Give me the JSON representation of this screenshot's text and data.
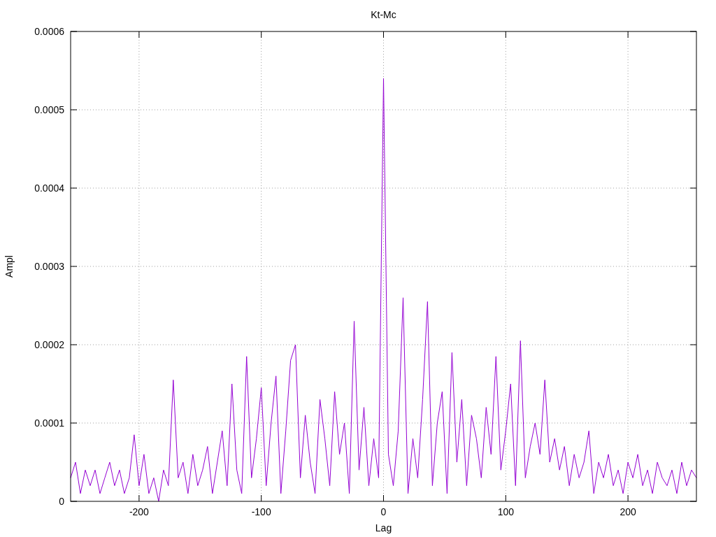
{
  "chart_data": {
    "type": "line",
    "title": "Kt-Mc",
    "xlabel": "Lag",
    "ylabel": "Ampl",
    "grid": true,
    "xlim": [
      -256,
      256
    ],
    "ylim": [
      0,
      0.0006
    ],
    "xticks": [
      -200,
      -100,
      0,
      100,
      200
    ],
    "yticks": [
      0,
      0.0001,
      0.0002,
      0.0003,
      0.0004,
      0.0005,
      0.0006
    ],
    "x": [
      -256,
      -252,
      -248,
      -244,
      -240,
      -236,
      -232,
      -228,
      -224,
      -220,
      -216,
      -212,
      -208,
      -204,
      -200,
      -196,
      -192,
      -188,
      -184,
      -180,
      -176,
      -172,
      -168,
      -164,
      -160,
      -156,
      -152,
      -148,
      -144,
      -140,
      -136,
      -132,
      -128,
      -124,
      -120,
      -116,
      -112,
      -108,
      -104,
      -100,
      -96,
      -92,
      -88,
      -84,
      -80,
      -76,
      -72,
      -68,
      -64,
      -60,
      -56,
      -52,
      -48,
      -44,
      -40,
      -36,
      -32,
      -28,
      -24,
      -20,
      -16,
      -12,
      -8,
      -4,
      0,
      4,
      8,
      12,
      16,
      20,
      24,
      28,
      32,
      36,
      40,
      44,
      48,
      52,
      56,
      60,
      64,
      68,
      72,
      76,
      80,
      84,
      88,
      92,
      96,
      100,
      104,
      108,
      112,
      116,
      120,
      124,
      128,
      132,
      136,
      140,
      144,
      148,
      152,
      156,
      160,
      164,
      168,
      172,
      176,
      180,
      184,
      188,
      192,
      196,
      200,
      204,
      208,
      212,
      216,
      220,
      224,
      228,
      232,
      236,
      240,
      244,
      248,
      252,
      256
    ],
    "series": [
      {
        "color": "#9400d3",
        "values": [
          3e-05,
          5e-05,
          1e-05,
          4e-05,
          2e-05,
          4e-05,
          1e-05,
          3e-05,
          5e-05,
          2e-05,
          4e-05,
          1e-05,
          3e-05,
          8.5e-05,
          2e-05,
          6e-05,
          1e-05,
          3e-05,
          0,
          4e-05,
          2e-05,
          0.000155,
          3e-05,
          5e-05,
          1e-05,
          6e-05,
          2e-05,
          4e-05,
          7e-05,
          1e-05,
          5e-05,
          9e-05,
          2e-05,
          0.00015,
          4e-05,
          1e-05,
          0.000185,
          3e-05,
          8e-05,
          0.000145,
          2e-05,
          0.0001,
          0.00016,
          1e-05,
          9e-05,
          0.00018,
          0.0002,
          3e-05,
          0.00011,
          5e-05,
          1e-05,
          0.00013,
          8e-05,
          2e-05,
          0.00014,
          6e-05,
          0.0001,
          1e-05,
          0.00023,
          4e-05,
          0.00012,
          2e-05,
          8e-05,
          3e-05,
          0.00054,
          6e-05,
          2e-05,
          9e-05,
          0.00026,
          1e-05,
          8e-05,
          3e-05,
          0.00013,
          0.000255,
          2e-05,
          0.0001,
          0.00014,
          1e-05,
          0.00019,
          5e-05,
          0.00013,
          2e-05,
          0.00011,
          8e-05,
          3e-05,
          0.00012,
          6e-05,
          0.000185,
          4e-05,
          9e-05,
          0.00015,
          2e-05,
          0.000205,
          3e-05,
          7e-05,
          0.0001,
          6e-05,
          0.000155,
          5e-05,
          8e-05,
          4e-05,
          7e-05,
          2e-05,
          6e-05,
          3e-05,
          5e-05,
          9e-05,
          1e-05,
          5e-05,
          3e-05,
          6e-05,
          2e-05,
          4e-05,
          1e-05,
          5e-05,
          3e-05,
          6e-05,
          2e-05,
          4e-05,
          1e-05,
          5e-05,
          3e-05,
          2e-05,
          4e-05,
          1e-05,
          5e-05,
          2e-05,
          4e-05,
          3e-05
        ]
      }
    ]
  }
}
